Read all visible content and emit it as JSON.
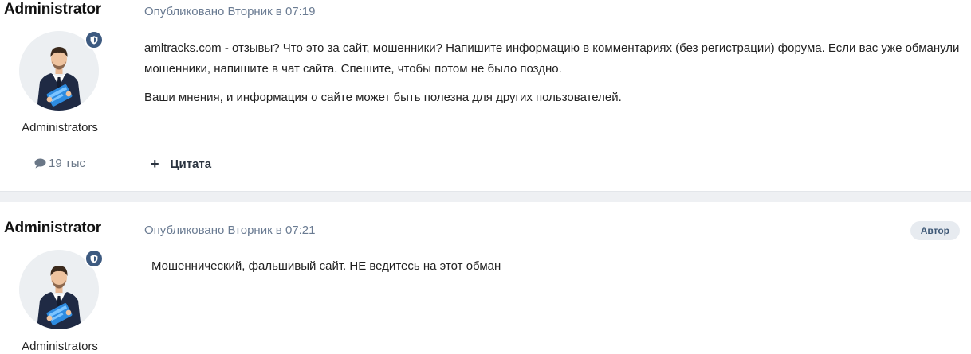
{
  "posts": [
    {
      "author": "Administrator",
      "group": "Administrators",
      "post_count": "19 тыс",
      "published": "Опубликовано Вторник в 07:19",
      "paragraphs": [
        "amltracks.com - отзывы? Что это за сайт, мошенники? Напишите информацию в комментариях (без регистрации) форума. Если вас уже обманули мошенники, напишите в чат сайта. Спешите, чтобы потом не было поздно.",
        "Ваши мнения, и информация о сайте может быть полезна для других пользователей."
      ],
      "quote_label": "Цитата"
    },
    {
      "author": "Administrator",
      "group": "Administrators",
      "published": "Опубликовано Вторник в 07:21",
      "author_tag": "Автор",
      "paragraphs": [
        "Мошеннический, фальшивый сайт. НЕ ведитесь на этот обман"
      ]
    }
  ],
  "icons": {
    "badge": "shield-icon",
    "count": "comment-icon",
    "quote": "plus-icon"
  },
  "colors": {
    "badge_bg": "#3d5a80",
    "meta_text": "#6a7b92",
    "separator": "#eef0f3",
    "tag_bg": "#e7ebf0",
    "tag_text": "#3e5876"
  }
}
